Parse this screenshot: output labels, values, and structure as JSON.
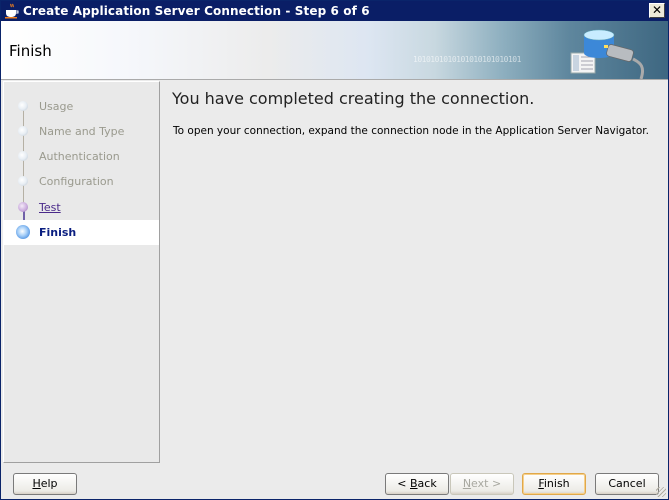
{
  "window": {
    "title": "Create Application Server Connection - Step 6 of 6",
    "icons": {
      "app": "java-cup-icon",
      "close": "close-icon"
    },
    "close_glyph": "✕"
  },
  "header": {
    "title": "Finish",
    "binary_text": "1010101010101010101010101"
  },
  "nav": {
    "items": [
      {
        "label": "Usage",
        "state": "visited"
      },
      {
        "label": "Name and Type",
        "state": "visited"
      },
      {
        "label": "Authentication",
        "state": "visited"
      },
      {
        "label": "Configuration",
        "state": "visited"
      },
      {
        "label": "Test",
        "state": "link"
      },
      {
        "label": "Finish",
        "state": "current"
      }
    ]
  },
  "content": {
    "heading": "You have completed creating the connection.",
    "description": "To open your connection, expand the connection node in the Application Server Navigator."
  },
  "buttons": {
    "help": {
      "pre": "",
      "mnemonic": "H",
      "post": "elp"
    },
    "back": {
      "pre": "< ",
      "mnemonic": "B",
      "post": "ack"
    },
    "next": {
      "pre": "",
      "mnemonic": "N",
      "post": "ext >"
    },
    "finish": {
      "pre": "",
      "mnemonic": "F",
      "post": "inish"
    },
    "cancel": {
      "pre": "",
      "mnemonic": "",
      "post": "Cancel"
    }
  }
}
